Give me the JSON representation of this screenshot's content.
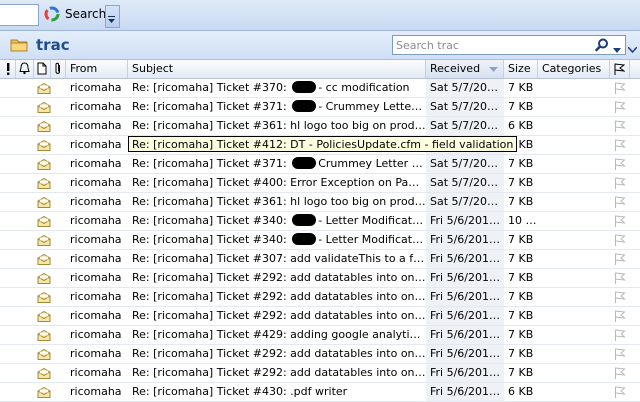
{
  "toolbar": {
    "search_label": "Search"
  },
  "folder": {
    "title": "trac",
    "search_placeholder": "Search trac"
  },
  "columns": {
    "from": "From",
    "subject": "Subject",
    "received": "Received",
    "size": "Size",
    "categories": "Categories"
  },
  "icons": {
    "importance": "exclamation-icon",
    "reminder": "bell-icon",
    "type": "document-icon",
    "attachment": "paperclip-icon",
    "read_message": "envelope-open-icon",
    "flag": "flag-icon"
  },
  "colors": {
    "accent": "#1f4e8c",
    "toolbar": "#c8daf2",
    "tooltip_bg": "#ffffe1"
  },
  "messages": [
    {
      "from": "ricomaha",
      "subject_a": "Re: [ricomaha] Ticket #370: ",
      "subject_b": "- cc modification",
      "redacted": true,
      "received": "Sat 5/7/2011 ...",
      "size": "7 KB"
    },
    {
      "from": "ricomaha",
      "subject_a": "Re: [ricomaha] Ticket #371: ",
      "subject_b": "- Crummey Letter modifi...",
      "redacted": true,
      "received": "Sat 5/7/2011 ...",
      "size": "7 KB"
    },
    {
      "from": "ricomaha",
      "subject_a": "Re: [ricomaha] Ticket #361: hl logo too big on producti...",
      "subject_b": "",
      "redacted": false,
      "received": "Sat 5/7/2011 ...",
      "size": "6 KB"
    },
    {
      "from": "ricomaha",
      "subject_a": "Re: [ricomaha] Ticket #412: DT - PoliciesUpdate.cfm - field validation",
      "subject_b": "",
      "redacted": false,
      "received": "Sat 5/7/2011 ...",
      "size": "7 KB"
    },
    {
      "from": "ricomaha",
      "subject_a": "Re: [ricomaha] Ticket #371: ",
      "subject_b": "Crummey Letter modifi...",
      "redacted": true,
      "received": "Sat 5/7/2011 ...",
      "size": "7 KB"
    },
    {
      "from": "ricomaha",
      "subject_a": "Re: [ricomaha] Ticket #400: Error Exception on Page /PN...",
      "subject_b": "",
      "redacted": false,
      "received": "Sat 5/7/2011 ...",
      "size": "7 KB"
    },
    {
      "from": "ricomaha",
      "subject_a": "Re: [ricomaha] Ticket #361: hl logo too big on producti...",
      "subject_b": "",
      "redacted": false,
      "received": "Sat 5/7/2011 ...",
      "size": "7 KB"
    },
    {
      "from": "ricomaha",
      "subject_a": "Re: [ricomaha] Ticket #340: ",
      "subject_b": "- Letter Modifications ...",
      "redacted": true,
      "received": "Fri 5/6/2011 ...",
      "size": "10 KB"
    },
    {
      "from": "ricomaha",
      "subject_a": "Re: [ricomaha] Ticket #340: ",
      "subject_b": "- Letter Modifications ...",
      "redacted": true,
      "received": "Fri 5/6/2011 ...",
      "size": "7 KB"
    },
    {
      "from": "ricomaha",
      "subject_a": "Re: [ricomaha] Ticket #307: add validateThis to a form fo...",
      "subject_b": "",
      "redacted": false,
      "received": "Fri 5/6/2011 ...",
      "size": "7 KB"
    },
    {
      "from": "ricomaha",
      "subject_a": "Re: [ricomaha] Ticket #292: add datatables into one cod...",
      "subject_b": "",
      "redacted": false,
      "received": "Fri 5/6/2011 ...",
      "size": "7 KB"
    },
    {
      "from": "ricomaha",
      "subject_a": "Re: [ricomaha] Ticket #292: add datatables into one cod...",
      "subject_b": "",
      "redacted": false,
      "received": "Fri 5/6/2011 ...",
      "size": "7 KB"
    },
    {
      "from": "ricomaha",
      "subject_a": "Re: [ricomaha] Ticket #292: add datatables into one cod...",
      "subject_b": "",
      "redacted": false,
      "received": "Fri 5/6/2011 ...",
      "size": "7 KB"
    },
    {
      "from": "ricomaha",
      "subject_a": "Re: [ricomaha] Ticket #429: adding google analytics to ...",
      "subject_b": "",
      "redacted": false,
      "received": "Fri 5/6/2011 ...",
      "size": "7 KB"
    },
    {
      "from": "ricomaha",
      "subject_a": "Re: [ricomaha] Ticket #292: add datatables into one cod...",
      "subject_b": "",
      "redacted": false,
      "received": "Fri 5/6/2011 ...",
      "size": "7 KB"
    },
    {
      "from": "ricomaha",
      "subject_a": "Re: [ricomaha] Ticket #292: add datatables into one cod...",
      "subject_b": "",
      "redacted": false,
      "received": "Fri 5/6/2011 ...",
      "size": "7 KB"
    },
    {
      "from": "ricomaha",
      "subject_a": "Re: [ricomaha] Ticket #430: .pdf writer",
      "subject_b": "",
      "redacted": false,
      "received": "Fri 5/6/2011 ...",
      "size": "6 KB"
    }
  ],
  "tooltip": {
    "text": "Re: [ricomaha] Ticket #412: DT - PoliciesUpdate.cfm - field validation"
  }
}
